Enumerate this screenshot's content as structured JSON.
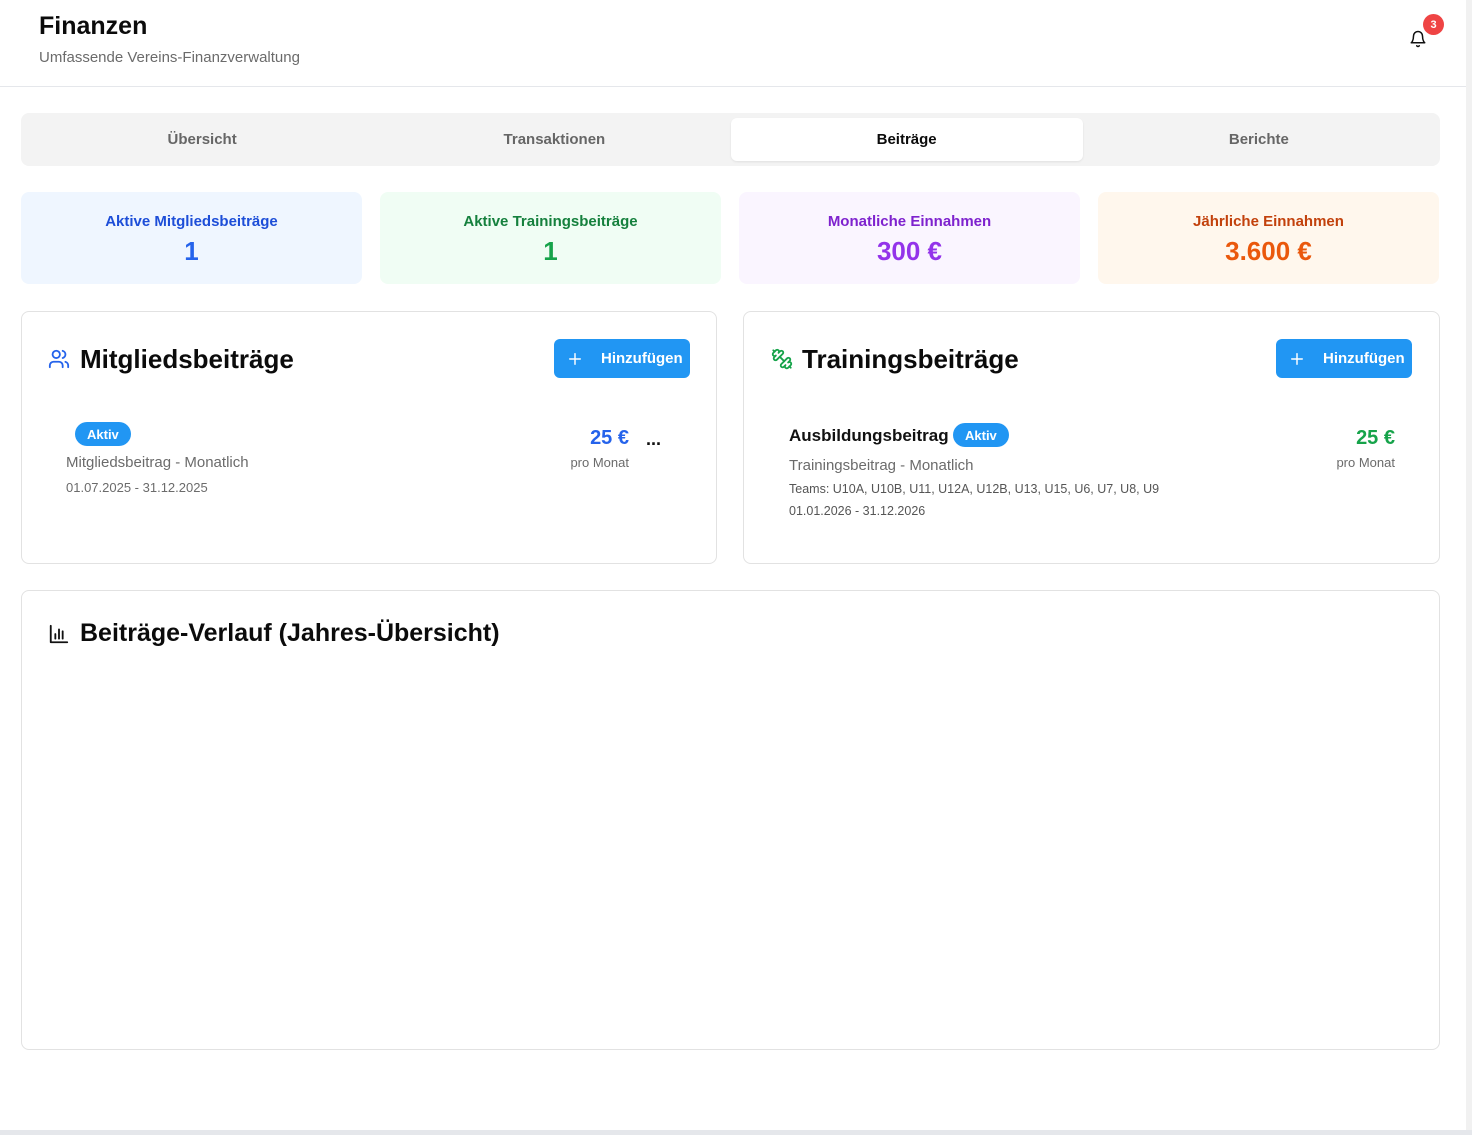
{
  "header": {
    "title": "Finanzen",
    "subtitle": "Umfassende Vereins-Finanzverwaltung",
    "notification_count": "3"
  },
  "tabs": [
    {
      "label": "Übersicht",
      "active": false
    },
    {
      "label": "Transaktionen",
      "active": false
    },
    {
      "label": "Beiträge",
      "active": true
    },
    {
      "label": "Berichte",
      "active": false
    }
  ],
  "stats": [
    {
      "label": "Aktive Mitgliedsbeiträge",
      "value": "1",
      "bg": "#eff6ff",
      "label_color": "#1d4ed8",
      "value_color": "#2563eb"
    },
    {
      "label": "Aktive Trainingsbeiträge",
      "value": "1",
      "bg": "#f0fdf4",
      "label_color": "#15803d",
      "value_color": "#16a34a"
    },
    {
      "label": "Monatliche Einnahmen",
      "value": "300 €",
      "bg": "#faf5ff",
      "label_color": "#7e22ce",
      "value_color": "#9333ea"
    },
    {
      "label": "Jährliche Einnahmen",
      "value": "3.600 €",
      "bg": "#fff7ed",
      "label_color": "#c2410c",
      "value_color": "#ea580c"
    }
  ],
  "membership_card": {
    "title": "Mitgliedsbeiträge",
    "add_label": "Hinzufügen",
    "item": {
      "status": "Aktiv",
      "type": "Mitgliedsbeitrag - Monatlich",
      "period": "01.07.2025 - 31.12.2025",
      "amount": "25 €",
      "per": "pro Monat",
      "more": "..."
    }
  },
  "training_card": {
    "title": "Trainingsbeiträge",
    "add_label": "Hinzufügen",
    "item": {
      "name": "Ausbildungsbeitrag",
      "status": "Aktiv",
      "type": "Trainingsbeitrag - Monatlich",
      "teams": "Teams: U10A, U10B, U11, U12A, U12B, U13, U15, U6, U7, U8, U9",
      "period": "01.01.2026 - 31.12.2026",
      "amount": "25 €",
      "per": "pro Monat"
    }
  },
  "history_card": {
    "title": "Beiträge-Verlauf (Jahres-Übersicht)"
  },
  "colors": {
    "accent": "#2196f3",
    "membership_amount": "#2563eb",
    "training_amount": "#16a34a",
    "badge_alert": "#ef4444"
  }
}
